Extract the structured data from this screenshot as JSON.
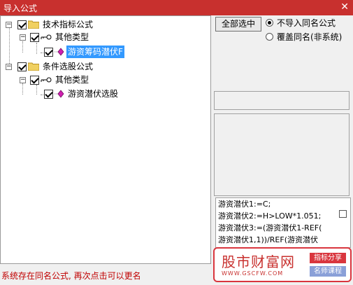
{
  "window": {
    "title": "导入公式",
    "close_glyph": "✕"
  },
  "tree": {
    "nodes": [
      {
        "label": "技术指标公式",
        "expander": "−",
        "checked": true
      },
      {
        "label": "其他类型",
        "expander": "−",
        "checked": true
      },
      {
        "label": "游资筹码潜伏F",
        "checked": true,
        "selected": true
      },
      {
        "label": "条件选股公式",
        "expander": "−",
        "checked": true
      },
      {
        "label": "其他类型",
        "expander": "−",
        "checked": true
      },
      {
        "label": "游资潜伏选股",
        "checked": true
      }
    ]
  },
  "actions": {
    "select_all_label": "全部选中"
  },
  "options": {
    "no_import": {
      "label": "不导入同名公式",
      "selected": true
    },
    "overwrite": {
      "label": "覆盖同名(非系统)",
      "selected": false
    }
  },
  "code_preview": {
    "lines": [
      "游资潜伏1:=C;",
      "游资潜伏2:=H>LOW*1.051;",
      "游资潜伏3:=(游资潜伏1-REF(",
      "游资潜伏1,1))/REF(游资潜伏"
    ]
  },
  "status": {
    "message": "系统存在同名公式, 再次点击可以更名"
  },
  "watermark": {
    "brand": "股市财富网",
    "url": "WWW.GSCFW.COM",
    "tag1": "指标分享",
    "tag2": "名师课程",
    "tag1_color": "#d9363e",
    "tag2_color": "#8aa0d8"
  }
}
